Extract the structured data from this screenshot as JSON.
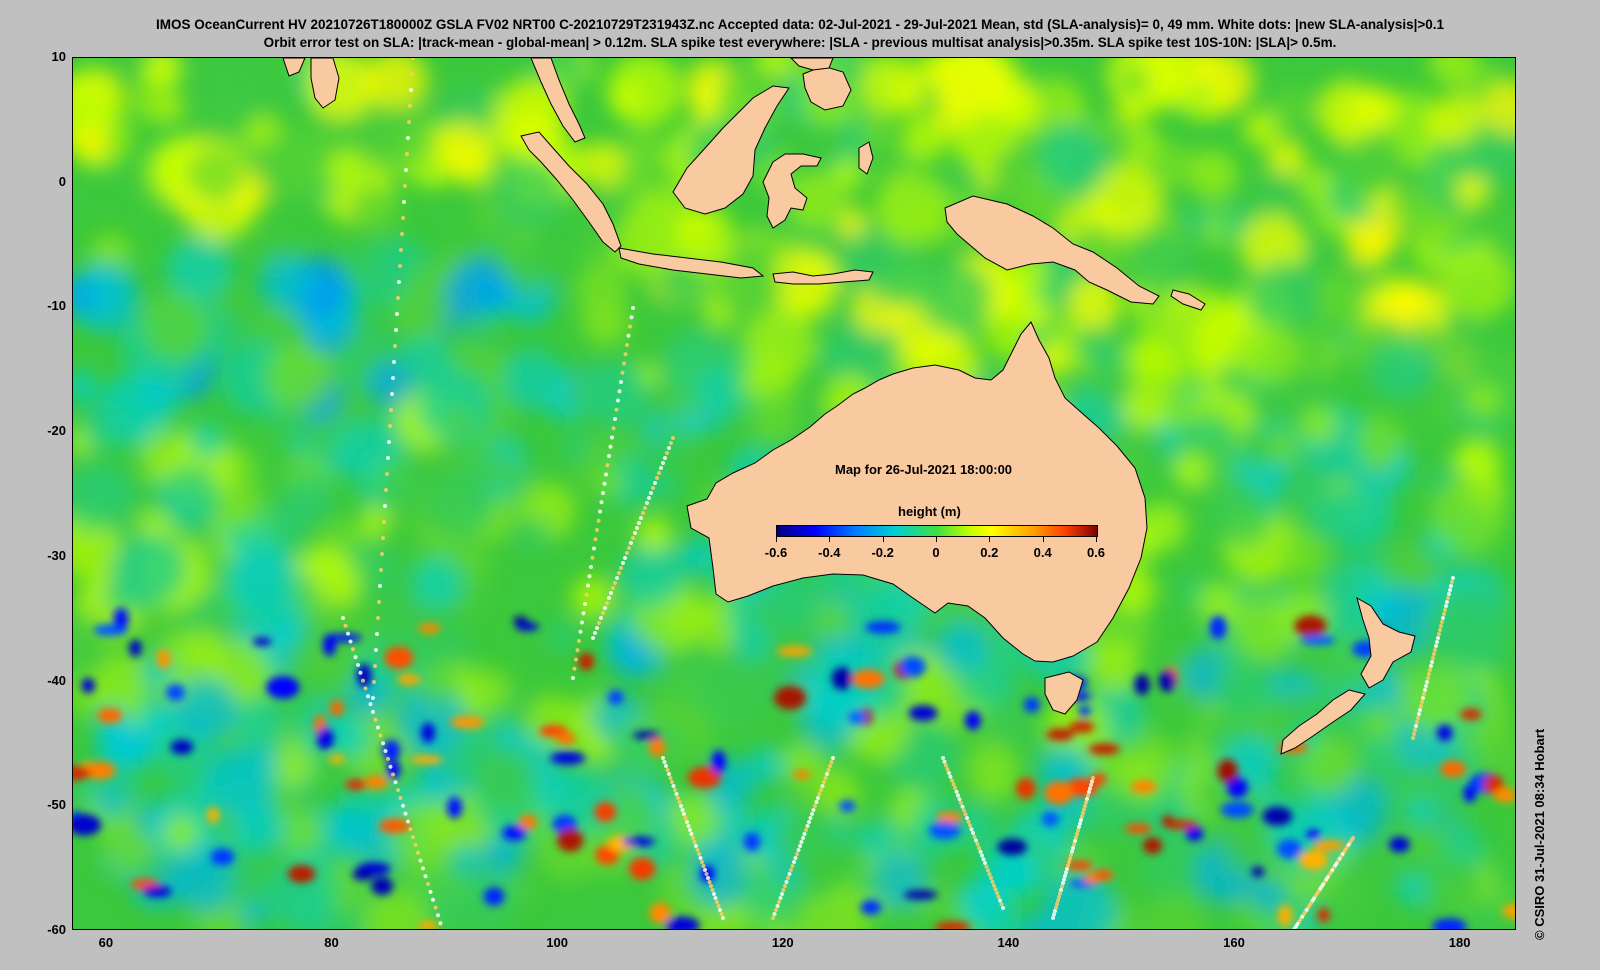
{
  "header": {
    "line1": "IMOS OceanCurrent HV 20210726T180000Z GSLA FV02 NRT00 C-20210729T231943Z.nc  Accepted data: 02-Jul-2021 - 29-Jul-2021 Mean, std (SLA-analysis)= 0, 49 mm. White dots: |new SLA-analysis|>0.1",
    "line2": "Orbit error test on SLA: |track-mean  - global-mean| > 0.12m.  SLA spike test everywhere: |SLA - previous multisat analysis|>0.35m. SLA spike test 10S-10N: |SLA|> 0.5m."
  },
  "map": {
    "time_label": "Map for 26-Jul-2021 18:00:00",
    "colorbar_title": "height (m)",
    "colorbar_ticks": [
      "-0.6",
      "-0.4",
      "-0.2",
      "0",
      "0.2",
      "0.4",
      "0.6"
    ],
    "colorbar_range": [
      -0.6,
      0.6
    ],
    "lon_ticks": [
      "60",
      "80",
      "100",
      "120",
      "140",
      "160",
      "180"
    ],
    "lat_ticks": [
      "10",
      "0",
      "-10",
      "-20",
      "-30",
      "-40",
      "-50",
      "-60"
    ],
    "lon_range": [
      57,
      185
    ],
    "lat_range": [
      -60,
      10
    ],
    "land_color": "#f9c9a0",
    "ocean_base_color": "#3cc83c"
  },
  "credit": "© CSIRO 31-Jul-2021 08:34 Hobart"
}
